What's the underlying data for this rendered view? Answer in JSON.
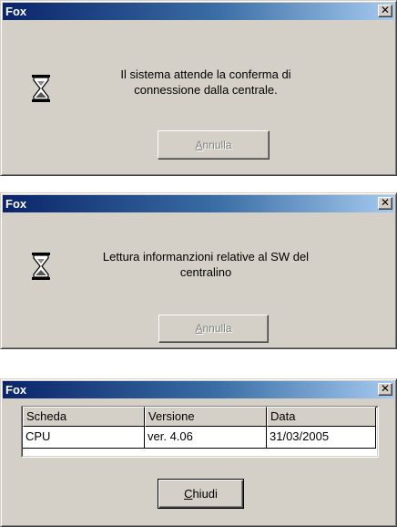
{
  "dialogs": [
    {
      "title": "Fox",
      "message_line1": "Il sistema attende la conferma di",
      "message_line2": "connessione dalla centrale.",
      "button_label_prefix": "",
      "button_hotkey": "A",
      "button_label_rest": "nnulla",
      "button_enabled": false
    },
    {
      "title": "Fox",
      "message_line1": "Lettura informanzioni relative al SW del",
      "message_line2": "centralino",
      "button_hotkey": "A",
      "button_label_rest": "nnulla",
      "button_enabled": false
    },
    {
      "title": "Fox",
      "table": {
        "headers": [
          "Scheda",
          "Versione",
          "Data"
        ],
        "rows": [
          [
            "CPU",
            "ver. 4.06",
            "31/03/2005"
          ]
        ]
      },
      "button_hotkey": "C",
      "button_label_rest": "hiudi",
      "button_enabled": true
    }
  ],
  "icons": {
    "close": "close-icon",
    "hourglass": "hourglass-icon"
  },
  "colors": {
    "face": "#d4d0c8",
    "title_start": "#0a246a",
    "title_end": "#a6caf0"
  }
}
